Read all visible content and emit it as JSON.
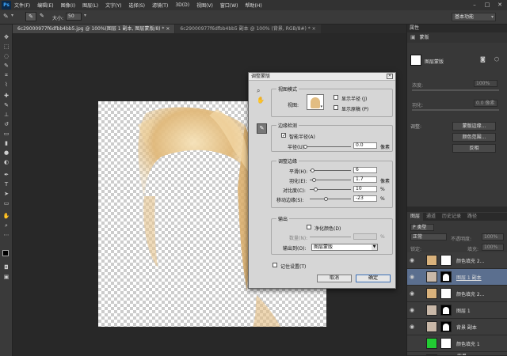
{
  "app": {
    "logo": "Ps"
  },
  "menu": [
    "文件(F)",
    "编辑(E)",
    "图像(I)",
    "图层(L)",
    "文字(Y)",
    "选择(S)",
    "滤镜(T)",
    "3D(D)",
    "视图(V)",
    "窗口(W)",
    "帮助(H)"
  ],
  "window_controls": {
    "minimize": "–",
    "maximize": "□",
    "close": "✕"
  },
  "options": {
    "size_label": "大小:",
    "size_value": "50",
    "workspace": "基本功能"
  },
  "tabs": [
    {
      "label": "6c29000977f6dfbb4bb5.jpg @ 100%(图层 1 副本, 图层蒙版/8) *",
      "close": "×"
    },
    {
      "label": "6c29000977f6dfbb4bb5 副本 @ 100% (背景, RGB/8#) *",
      "close": "×"
    }
  ],
  "properties": {
    "header": "属性",
    "subheader": "蒙版",
    "mask_label": "图层蒙版",
    "density_label": "浓度:",
    "density_value": "100%",
    "feather_label": "羽化:",
    "feather_value": "0.0 像素",
    "adjust_label": "调整:",
    "buttons": [
      "蒙版边缘...",
      "颜色范围...",
      "反相"
    ]
  },
  "layers": {
    "tabs": [
      "图层",
      "通道",
      "历史记录",
      "路径"
    ],
    "kind": "P 类型",
    "blend_mode": "正常",
    "opacity_label": "不透明度:",
    "opacity_value": "100%",
    "lock_label": "锁定:",
    "fill_label": "填充:",
    "fill_value": "100%",
    "items": [
      {
        "name": "颜色填充 2...",
        "thumb_color": "#d9b27c",
        "mask": "white",
        "selected": false
      },
      {
        "name": "图层 1 副本",
        "thumb_color": "#c9b8a8",
        "mask": "hair",
        "selected": true
      },
      {
        "name": "颜色填充 2...",
        "thumb_color": "#d9b27c",
        "mask": "white",
        "selected": false
      },
      {
        "name": "图层 1",
        "thumb_color": "#c9b8a8",
        "mask": "hair",
        "selected": false
      },
      {
        "name": "背景 副本",
        "thumb_color": "#c9b8a8",
        "mask": "hair",
        "selected": false
      },
      {
        "name": "颜色填充 1",
        "thumb_color": "#22cc33",
        "mask": "white",
        "selected": false
      },
      {
        "name": "背景",
        "thumb_color": "#c9b8a8",
        "mask": "none",
        "selected": false
      }
    ]
  },
  "dialog": {
    "title": "调整蒙版",
    "view_mode": {
      "legend": "视图模式",
      "view_label": "视图:",
      "show_radius": "显示半径 (J)",
      "show_original": "显示原稿 (P)"
    },
    "edge_detection": {
      "legend": "边缘检测",
      "smart_radius": "智能半径(A)",
      "radius_label": "半径(U):",
      "radius_value": "0.0",
      "radius_unit": "像素"
    },
    "adjust_edge": {
      "legend": "调整边缘",
      "smooth_label": "平滑(H):",
      "smooth_value": "6",
      "feather_label": "羽化(E):",
      "feather_value": "1.7",
      "feather_unit": "像素",
      "contrast_label": "对比度(C):",
      "contrast_value": "10",
      "contrast_unit": "%",
      "shift_label": "移动边缘(S):",
      "shift_value": "-23",
      "shift_unit": "%"
    },
    "output": {
      "legend": "输出",
      "decontaminate": "净化颜色(D)",
      "amount_label": "数量(N):",
      "amount_unit": "%",
      "output_to_label": "输出到(O):",
      "output_to_value": "图层蒙版"
    },
    "remember": "记住设置(T)",
    "cancel": "取消",
    "ok": "确定"
  }
}
